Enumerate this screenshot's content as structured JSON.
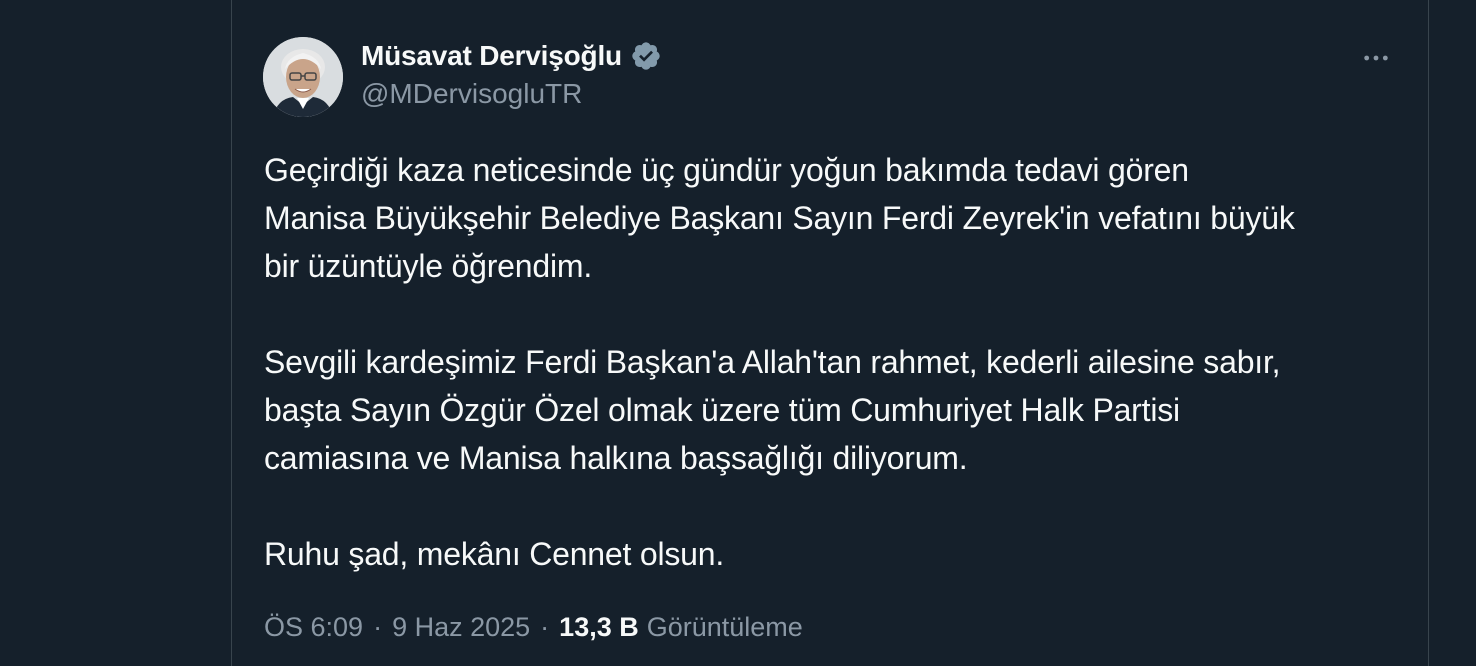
{
  "author": {
    "display_name": "Müsavat Dervişoğlu",
    "handle": "@MDervisogluTR",
    "verified": true,
    "verified_color": "#829aab"
  },
  "tweet": {
    "paragraphs": [
      "Geçirdiği kaza neticesinde üç gündür yoğun bakımda tedavi gören\nManisa Büyükşehir Belediye Başkanı Sayın Ferdi Zeyrek'in vefatını büyük\nbir üzüntüyle öğrendim.",
      "Sevgili kardeşimiz Ferdi Başkan'a Allah'tan rahmet, kederli ailesine sabır,\nbaşta Sayın Özgür Özel olmak üzere tüm Cumhuriyet Halk Partisi\ncamiasına ve Manisa halkına başsağlığı diliyorum.",
      "Ruhu şad, mekânı Cennet olsun."
    ]
  },
  "meta": {
    "time": "ÖS 6:09",
    "separator": "·",
    "date": "9 Haz 2025",
    "views_count": "13,3 B",
    "views_label": "Görüntüleme"
  },
  "icons": {
    "more": "more-horizontal-icon",
    "verified": "verified-badge-icon"
  },
  "colors": {
    "background": "#15202b",
    "border": "#38444d",
    "text_primary": "#f7f9f9",
    "text_secondary": "#8b98a5"
  }
}
